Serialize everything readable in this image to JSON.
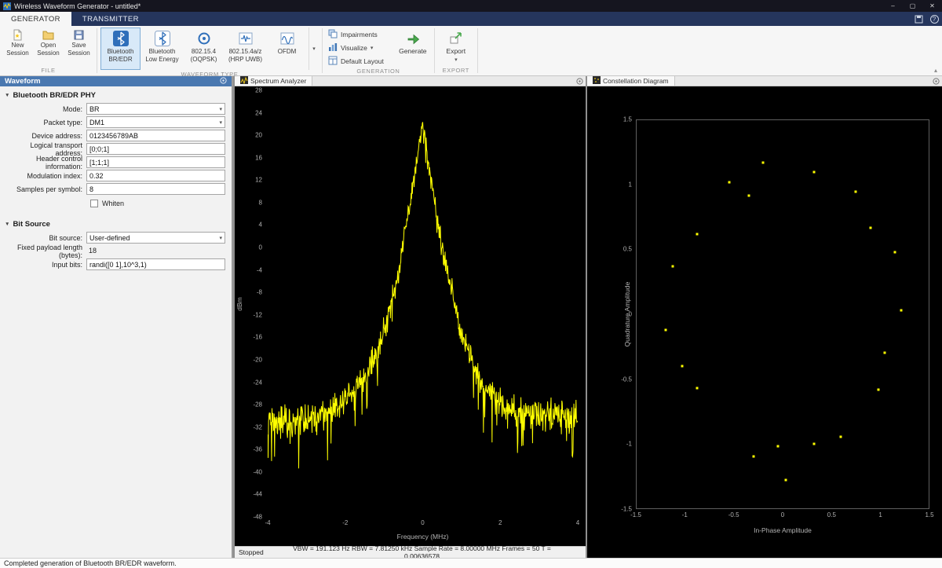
{
  "window": {
    "title": "Wireless Waveform Generator - untitled*"
  },
  "glyphs": {
    "chevron_down": "▾",
    "section_tri": "▼",
    "minimize": "–",
    "maximize": "▢",
    "close": "✕",
    "help": "?",
    "collapse": "▴"
  },
  "ribbon_tabs": {
    "generator": "GENERATOR",
    "transmitter": "TRANSMITTER"
  },
  "toolstrip": {
    "file": {
      "section_label": "FILE",
      "new": "New\nSession",
      "open": "Open\nSession",
      "save": "Save\nSession"
    },
    "waveform_type": {
      "section_label": "WAVEFORM TYPE",
      "items": [
        {
          "label": "Bluetooth\nBR/EDR"
        },
        {
          "label": "Bluetooth\nLow Energy"
        },
        {
          "label": "802.15.4\n(OQPSK)"
        },
        {
          "label": "802.15.4a/z\n(HRP UWB)"
        },
        {
          "label": "OFDM"
        }
      ]
    },
    "generation": {
      "section_label": "GENERATION",
      "impairments": "Impairments",
      "visualize": "Visualize",
      "default_layout": "Default Layout",
      "generate": "Generate"
    },
    "export": {
      "section_label": "EXPORT",
      "export": "Export"
    }
  },
  "waveform_panel": {
    "title": "Waveform",
    "phy_section": "Bluetooth BR/EDR PHY",
    "fields": [
      {
        "label": "Mode:",
        "value": "BR"
      },
      {
        "label": "Packet type:",
        "value": "DM1"
      },
      {
        "label": "Device address:",
        "value": "0123456789AB"
      },
      {
        "label": "Logical transport address:",
        "value": "[0;0;1]"
      },
      {
        "label": "Header control information:",
        "value": "[1;1;1]"
      },
      {
        "label": "Modulation index:",
        "value": "0.32"
      },
      {
        "label": "Samples per symbol:",
        "value": "8"
      }
    ],
    "whiten_label": "Whiten",
    "bit_section": "Bit Source",
    "bit_fields": [
      {
        "label": "Bit source:",
        "value": "User-defined"
      },
      {
        "label": "Fixed payload length (bytes):",
        "value": "18"
      },
      {
        "label": "Input bits:",
        "value": "randi([0 1],10^3,1)"
      }
    ]
  },
  "spectrum_panel": {
    "tab": "Spectrum Analyzer",
    "status_left": "Stopped",
    "status_center": "VBW = 191.123 Hz   RBW = 7.81250 kHz   Sample Rate = 8.00000 MHz   Frames = 50   T = 0.00636578"
  },
  "constellation_panel": {
    "tab": "Constellation Diagram"
  },
  "statusbar": {
    "message": "Completed generation of Bluetooth BR/EDR waveform."
  },
  "chart_data": [
    {
      "type": "line",
      "title": "Spectrum Analyzer",
      "xlabel": "Frequency (MHz)",
      "ylabel": "dBm",
      "xlim": [
        -4,
        4
      ],
      "ylim": [
        -48,
        28
      ],
      "xticks": [
        -4,
        -2,
        0,
        2,
        4
      ],
      "yticks": [
        28,
        24,
        20,
        16,
        12,
        8,
        4,
        0,
        -4,
        -8,
        -12,
        -16,
        -20,
        -24,
        -28,
        -32,
        -36,
        -40,
        -44,
        -48
      ],
      "color": "#ffff00",
      "grid": false,
      "peak_dbm": 22,
      "noise_floor_dbm": -31,
      "envelope_points": [
        [
          -4,
          -31
        ],
        [
          -3.2,
          -31
        ],
        [
          -2.6,
          -30
        ],
        [
          -2.2,
          -28.5
        ],
        [
          -1.8,
          -26
        ],
        [
          -1.5,
          -23
        ],
        [
          -1.25,
          -20
        ],
        [
          -1.05,
          -16
        ],
        [
          -0.9,
          -12
        ],
        [
          -0.75,
          -8
        ],
        [
          -0.6,
          -3
        ],
        [
          -0.5,
          1
        ],
        [
          -0.4,
          5
        ],
        [
          -0.3,
          9
        ],
        [
          -0.2,
          13
        ],
        [
          -0.12,
          17
        ],
        [
          -0.05,
          20
        ],
        [
          0,
          22
        ],
        [
          0.05,
          20
        ],
        [
          0.12,
          17
        ],
        [
          0.2,
          13
        ],
        [
          0.3,
          9
        ],
        [
          0.4,
          4
        ],
        [
          0.5,
          0
        ],
        [
          0.62,
          -4
        ],
        [
          0.75,
          -8
        ],
        [
          0.9,
          -13
        ],
        [
          1.1,
          -17
        ],
        [
          1.3,
          -21
        ],
        [
          1.6,
          -25
        ],
        [
          2,
          -28
        ],
        [
          2.5,
          -29.5
        ],
        [
          3.2,
          -30
        ],
        [
          4,
          -30
        ]
      ],
      "noise_db": 4,
      "noise_seed": 42,
      "n_points": 720
    },
    {
      "type": "scatter",
      "title": "Constellation Diagram",
      "xlabel": "In-Phase Amplitude",
      "ylabel": "Quadrature Amplitude",
      "xlim": [
        -1.5,
        1.5
      ],
      "ylim": [
        -1.5,
        1.5
      ],
      "xticks": [
        -1.5,
        -1,
        -0.5,
        0,
        0.5,
        1,
        1.5
      ],
      "yticks": [
        1.5,
        1,
        0.5,
        0,
        -0.5,
        -1,
        -1.5
      ],
      "color": "#ffff00",
      "grid": false,
      "points": [
        [
          -0.2,
          1.17
        ],
        [
          0.32,
          1.1
        ],
        [
          -0.55,
          1.02
        ],
        [
          0.75,
          0.95
        ],
        [
          -0.35,
          0.92
        ],
        [
          0.9,
          0.67
        ],
        [
          -0.88,
          0.62
        ],
        [
          1.15,
          0.48
        ],
        [
          -1.13,
          0.37
        ],
        [
          1.22,
          0.03
        ],
        [
          -1.2,
          -0.12
        ],
        [
          1.05,
          -0.3
        ],
        [
          -1.03,
          -0.4
        ],
        [
          -0.88,
          -0.57
        ],
        [
          0.98,
          -0.58
        ],
        [
          0.32,
          -1.0
        ],
        [
          0.6,
          -0.95
        ],
        [
          -0.3,
          -1.1
        ],
        [
          0.03,
          -1.28
        ],
        [
          -0.05,
          -1.02
        ]
      ]
    }
  ]
}
